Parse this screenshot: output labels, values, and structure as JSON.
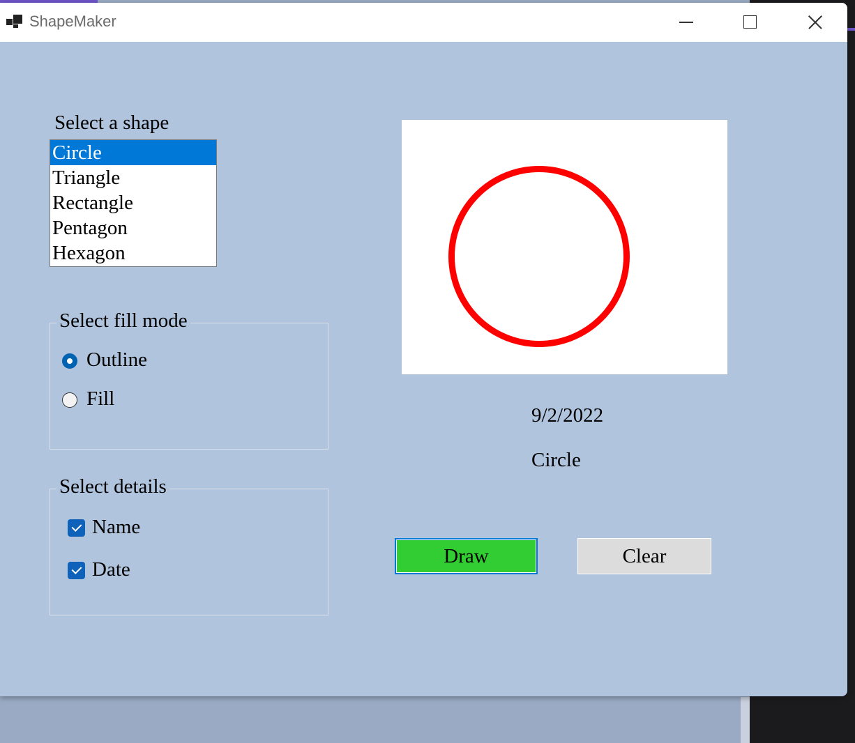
{
  "window": {
    "title": "ShapeMaker",
    "icon": "app-window-icon"
  },
  "shape_list": {
    "label": "Select a shape",
    "items": [
      "Circle",
      "Triangle",
      "Rectangle",
      "Pentagon",
      "Hexagon"
    ],
    "selected": "Circle"
  },
  "fill_mode": {
    "title": "Select fill mode",
    "options": [
      {
        "label": "Outline",
        "checked": true
      },
      {
        "label": "Fill",
        "checked": false
      }
    ]
  },
  "details": {
    "title": "Select details",
    "options": [
      {
        "label": "Name",
        "checked": true
      },
      {
        "label": "Date",
        "checked": true
      }
    ]
  },
  "canvas": {
    "shape": "circle",
    "mode": "outline",
    "stroke_color": "#ff0000",
    "background": "#ffffff"
  },
  "output": {
    "date": "9/2/2022",
    "name": "Circle"
  },
  "buttons": {
    "draw": "Draw",
    "clear": "Clear"
  },
  "colors": {
    "window_background": "#b0c4de",
    "selection": "#0078d7",
    "draw_button": "#32cd32",
    "clear_button": "#dcdcdc"
  }
}
